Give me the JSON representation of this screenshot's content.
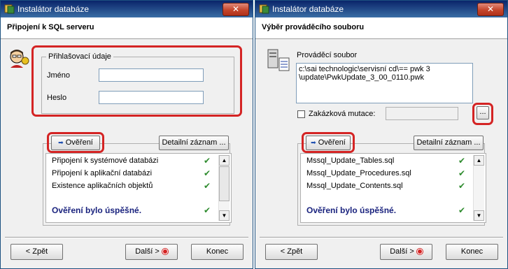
{
  "left": {
    "title": "Instalátor databáze",
    "close_glyph": "✕",
    "header_title": "Připojení k SQL serveru",
    "login_group_title": "Přihlašovací údaje",
    "name_label": "Jméno",
    "name_value": "",
    "password_label": "Heslo",
    "password_value": "",
    "verify_button": "Ověření",
    "detail_button": "Detailní záznam ...",
    "checks": [
      {
        "label": "Připojení k systémové databázi",
        "status": "✔"
      },
      {
        "label": "Připojení k aplikační databázi",
        "status": "✔"
      },
      {
        "label": "Existence aplikačních objektů",
        "status": "✔"
      }
    ],
    "success_text": "Ověření bylo úspěšné.",
    "success_status": "✔",
    "back_button": "< Zpět",
    "next_button": "Další >",
    "end_button": "Konec"
  },
  "right": {
    "title": "Instalátor databáze",
    "close_glyph": "✕",
    "header_title": "Výběr prováděcího souboru",
    "exec_file_label": "Prováděcí soubor",
    "exec_file_value": "c:\\sai technologic\\servisní cd\\== pwk 3\n\\update\\PwkUpdate_3_00_0110.pwk",
    "mutation_label": "Zakázková mutace:",
    "mutation_value": "",
    "browse_button": "...",
    "verify_button": "Ověření",
    "detail_button": "Detailní záznam ...",
    "files": [
      {
        "label": "Mssql_Update_Tables.sql",
        "status": "✔"
      },
      {
        "label": "Mssql_Update_Procedures.sql",
        "status": "✔"
      },
      {
        "label": "Mssql_Update_Contents.sql",
        "status": "✔"
      }
    ],
    "success_text": "Ověření bylo úspěšné.",
    "success_status": "✔",
    "back_button": "< Zpět",
    "next_button": "Další >",
    "end_button": "Konec"
  },
  "colors": {
    "highlight": "#d42424",
    "check": "#2e8b2e",
    "success_text": "#1a237e"
  }
}
